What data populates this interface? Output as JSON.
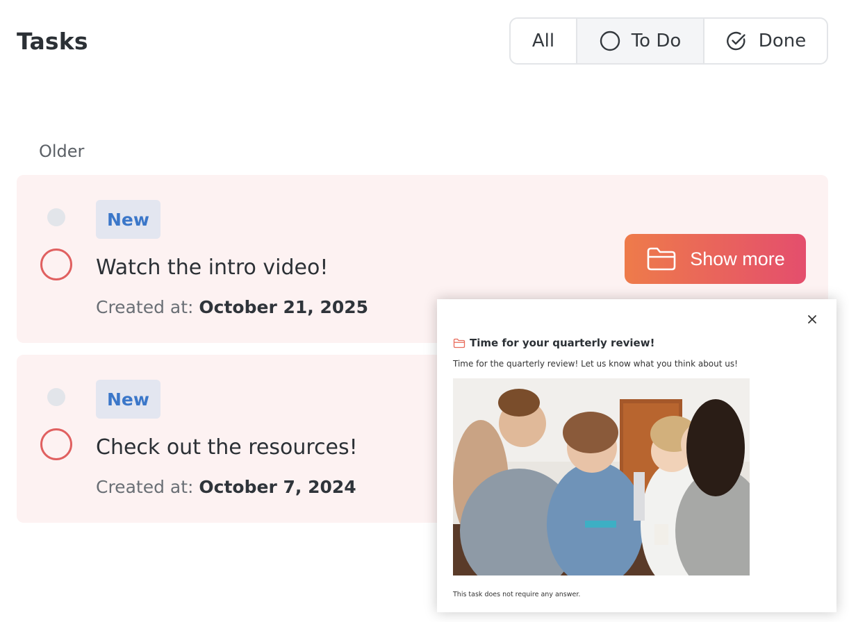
{
  "header": {
    "title": "Tasks"
  },
  "filters": [
    {
      "label": "All",
      "icon": "none"
    },
    {
      "label": "To Do",
      "icon": "circle-icon"
    },
    {
      "label": "Done",
      "icon": "check-circle-icon"
    }
  ],
  "group": {
    "label": "Older"
  },
  "tasks": [
    {
      "badge": "New",
      "title": "Watch the intro video!",
      "created_prefix": "Created at:",
      "created_date": "October 21, 2025"
    },
    {
      "badge": "New",
      "title": "Check out the resources!",
      "created_prefix": "Created at:",
      "created_date": "October 7, 2024"
    }
  ],
  "show_more": {
    "label": "Show more",
    "icon": "folder-icon"
  },
  "popup": {
    "title": "Time for your quarterly review!",
    "description": "Time for the quarterly review! Let us know what you think about us!",
    "footer": "This task does not require any answer.",
    "close_icon": "close-icon"
  },
  "colors": {
    "accent_red": "#e06060",
    "badge_bg": "#e3e6f0",
    "badge_text": "#3b77c9",
    "card_bg": "#fdf2f2",
    "button_gradient_start": "#ee7b4a",
    "button_gradient_end": "#e44e6d"
  }
}
